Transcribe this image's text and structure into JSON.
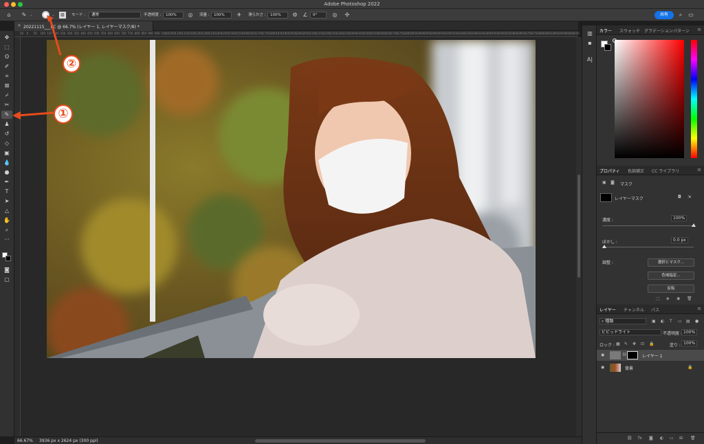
{
  "app": {
    "title": "Adobe Photoshop 2022"
  },
  "options_bar": {
    "mode_label": "モード :",
    "mode_value": "通常",
    "opacity_label": "不透明度 :",
    "opacity_value": "100%",
    "flow_label": "流量 :",
    "flow_value": "100%",
    "smoothing_label": "滑らかさ :",
    "smoothing_value": "100%",
    "angle_value": "0°",
    "share_label": "共有"
  },
  "document": {
    "tab_title": "20221115___PC @ 66.7% (レイヤー 1, レイヤーマスク/8) *",
    "zoom": "66.67%",
    "info": "3936 px x 2624 px (300 ppi)"
  },
  "ruler_ticks": [
    "50",
    "0",
    "50",
    "100",
    "150",
    "200",
    "250",
    "300",
    "350",
    "400",
    "450",
    "500",
    "550",
    "600",
    "650",
    "700",
    "750",
    "800",
    "850",
    "900",
    "950",
    "1000",
    "1050",
    "1100",
    "1150",
    "1200",
    "1250",
    "1300",
    "1350",
    "1400",
    "1450",
    "1500",
    "1550",
    "1600",
    "1650",
    "1700",
    "1750",
    "1800",
    "1850",
    "1900",
    "1950",
    "2000",
    "2050",
    "2100",
    "2150",
    "2200",
    "2250",
    "2300",
    "2350",
    "2400",
    "2450",
    "2500",
    "2550",
    "2600",
    "2650",
    "2700",
    "2750",
    "2800",
    "2850",
    "2900",
    "2950",
    "3000",
    "3050",
    "3100",
    "3150",
    "3200",
    "3250",
    "3300",
    "3350",
    "3400",
    "3450",
    "3500",
    "3550",
    "3600",
    "3650",
    "3700",
    "3750",
    "3800",
    "3850",
    "3900",
    "3950",
    "4000",
    "4050"
  ],
  "color_panel": {
    "tabs": [
      "カラー",
      "スウォッチ",
      "グラデーション",
      "パターン"
    ]
  },
  "properties_panel": {
    "tabs": [
      "プロパティ",
      "色調補正",
      "CC ライブラリ"
    ],
    "mask_label": "マスク",
    "layer_mask_label": "レイヤーマスク",
    "density_label": "濃度 :",
    "density_value": "100%",
    "feather_label": "ぼかし :",
    "feather_value": "0.0 px",
    "adjust_label": "調整 :",
    "btn_select_mask": "選択とマスク...",
    "btn_color_range": "色域指定...",
    "btn_invert": "反転"
  },
  "layers_panel": {
    "tabs": [
      "レイヤー",
      "チャンネル",
      "パス"
    ],
    "filter_kind": "種類",
    "blend_mode": "ビビッドライト",
    "opacity_label": "不透明度 :",
    "opacity_value": "100%",
    "lock_label": "ロック :",
    "fill_label": "塗り :",
    "fill_value": "100%",
    "layers": [
      {
        "name": "レイヤー 1"
      },
      {
        "name": "背景"
      }
    ]
  },
  "annotations": {
    "one": "①",
    "two": "②"
  },
  "colors": {
    "accent": "#1473e6",
    "annotation": "#e84c1e"
  }
}
